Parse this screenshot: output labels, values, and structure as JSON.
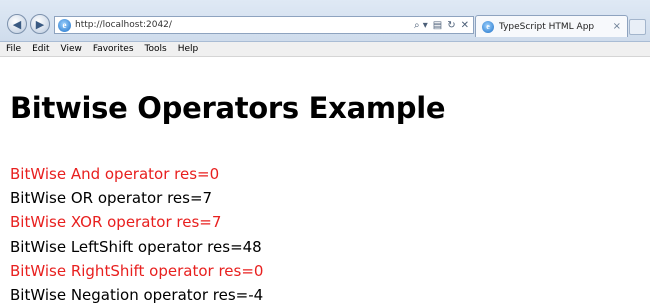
{
  "browser": {
    "url": "http://localhost:2042/",
    "tab_title": "TypeScript HTML App",
    "tab_close_glyph": "×",
    "address_tools": [
      "⌕ ▾",
      "▤",
      "↻",
      "✕"
    ]
  },
  "menu": {
    "items": [
      "File",
      "Edit",
      "View",
      "Favorites",
      "Tools",
      "Help"
    ]
  },
  "page": {
    "title": "Bitwise Operators Example",
    "results": [
      {
        "text": "BitWise And operator res=0",
        "color": "#e8201f"
      },
      {
        "text": "BitWise OR operator res=7",
        "color": "#000000"
      },
      {
        "text": "BitWise XOR operator res=7",
        "color": "#e8201f"
      },
      {
        "text": "BitWise LeftShift operator res=48",
        "color": "#000000"
      },
      {
        "text": "BitWise RightShift operator res=0",
        "color": "#e8201f"
      },
      {
        "text": "BitWise Negation operator res=-4",
        "color": "#000000"
      }
    ]
  }
}
